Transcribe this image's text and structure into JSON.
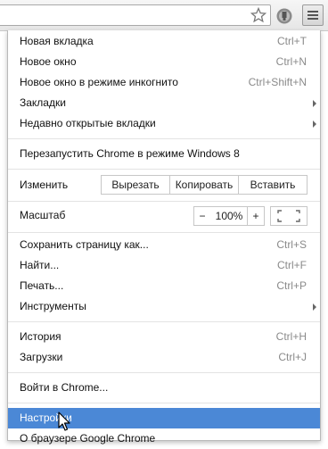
{
  "toolbar": {
    "star_icon": "star-icon",
    "extension_icon": "shield-icon",
    "menu_icon": "hamburger-icon"
  },
  "menu": {
    "group1": [
      {
        "label": "Новая вкладка",
        "shortcut": "Ctrl+T"
      },
      {
        "label": "Новое окно",
        "shortcut": "Ctrl+N"
      },
      {
        "label": "Новое окно в режиме инкогнито",
        "shortcut": "Ctrl+Shift+N"
      },
      {
        "label": "Закладки",
        "submenu": true
      },
      {
        "label": "Недавно открытые вкладки",
        "submenu": true
      }
    ],
    "relaunch": {
      "label": "Перезапустить Chrome в режиме Windows 8"
    },
    "edit": {
      "label": "Изменить",
      "cut": "Вырезать",
      "copy": "Копировать",
      "paste": "Вставить"
    },
    "zoom": {
      "label": "Масштаб",
      "minus": "−",
      "value": "100%",
      "plus": "+",
      "fullscreen_icon": "fullscreen-icon"
    },
    "group2": [
      {
        "label": "Сохранить страницу как...",
        "shortcut": "Ctrl+S"
      },
      {
        "label": "Найти...",
        "shortcut": "Ctrl+F"
      },
      {
        "label": "Печать...",
        "shortcut": "Ctrl+P"
      },
      {
        "label": "Инструменты",
        "submenu": true
      }
    ],
    "group3": [
      {
        "label": "История",
        "shortcut": "Ctrl+H"
      },
      {
        "label": "Загрузки",
        "shortcut": "Ctrl+J"
      }
    ],
    "signin": {
      "label": "Войти в Chrome..."
    },
    "settings": {
      "label": "Настройки",
      "highlighted": true
    },
    "about": {
      "label": "О браузере Google Chrome"
    }
  },
  "colors": {
    "highlight": "#4b88d6",
    "shortcut_text": "#8a8a8a"
  }
}
